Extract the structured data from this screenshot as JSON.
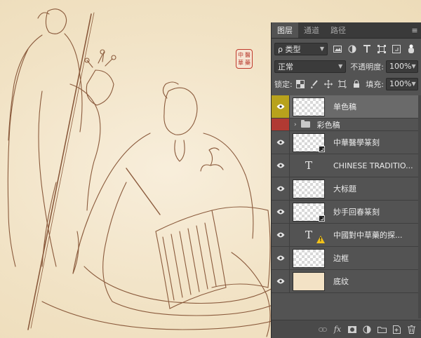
{
  "seal": {
    "chars": [
      "中",
      "醫",
      "華",
      "藥"
    ]
  },
  "panel": {
    "tabs": [
      {
        "label": "图层",
        "active": true
      },
      {
        "label": "通道",
        "active": false
      },
      {
        "label": "路径",
        "active": false
      }
    ],
    "menu_glyph": "≡",
    "filter": {
      "label": "ρ 类型"
    },
    "blend_mode": "正常",
    "opacity_label": "不透明度:",
    "opacity_value": "100%",
    "lock_label": "锁定:",
    "fill_label": "填充:",
    "fill_value": "100%",
    "layers": [
      {
        "name": "单色稿",
        "kind": "pixel",
        "selected": true,
        "eye": "yellow"
      },
      {
        "name": "彩色稿",
        "kind": "group",
        "eye": "red"
      },
      {
        "name": "中華醫學篆刻",
        "kind": "smart"
      },
      {
        "name": "CHINESE TRADITIO...",
        "kind": "text"
      },
      {
        "name": "大标题",
        "kind": "pixel"
      },
      {
        "name": "妙手回春篆刻",
        "kind": "smart"
      },
      {
        "name": "中國對中草藥的探...",
        "kind": "text",
        "warning": true
      },
      {
        "name": "边框",
        "kind": "pixel"
      },
      {
        "name": "底纹",
        "kind": "fill"
      }
    ],
    "footer_icons": [
      "link-icon",
      "fx-icon",
      "mask-icon",
      "adjustment-icon",
      "folder-icon",
      "new-layer-icon",
      "trash-icon"
    ],
    "footer_glyphs": {
      "fx": "fx"
    }
  }
}
